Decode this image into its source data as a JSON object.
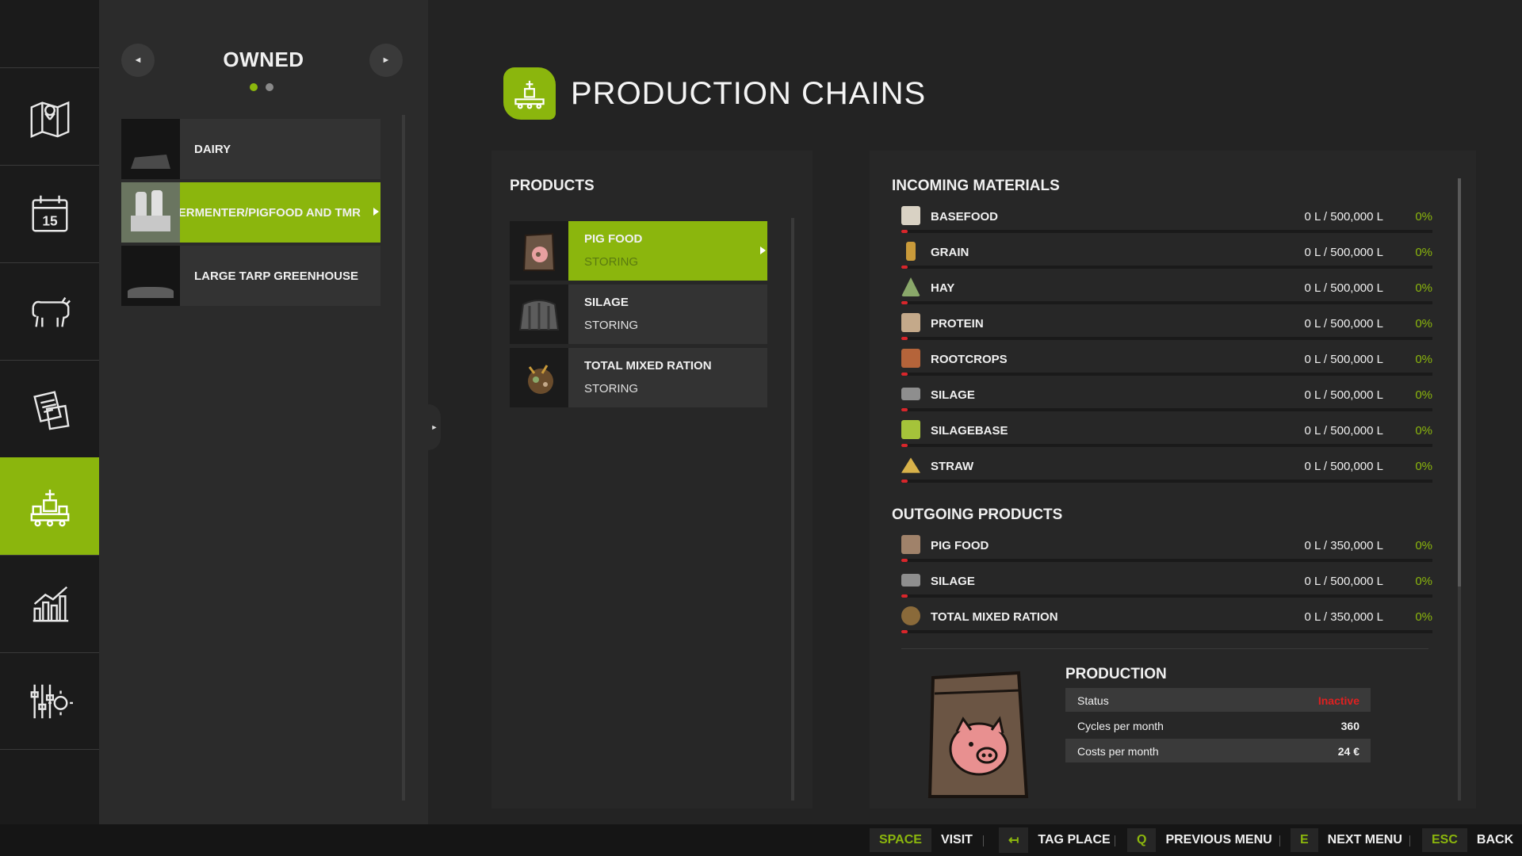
{
  "rail": {
    "items": [
      {
        "name": "map-icon"
      },
      {
        "name": "calendar-icon",
        "text": "15"
      },
      {
        "name": "animals-icon"
      },
      {
        "name": "contracts-icon"
      },
      {
        "name": "production-icon",
        "active": true
      },
      {
        "name": "statistics-icon"
      },
      {
        "name": "settings-icon"
      }
    ]
  },
  "owned": {
    "title": "OWNED",
    "prev": "◄",
    "next": "►",
    "items": [
      {
        "label": "DAIRY"
      },
      {
        "label": "FERMENTER/PIGFOOD AND TMR",
        "active": true
      },
      {
        "label": "LARGE TARP GREENHOUSE"
      }
    ]
  },
  "header": {
    "title": "PRODUCTION CHAINS"
  },
  "products": {
    "title": "PRODUCTS",
    "items": [
      {
        "name": "PIG FOOD",
        "state": "STORING",
        "active": true
      },
      {
        "name": "SILAGE",
        "state": "STORING"
      },
      {
        "name": "TOTAL MIXED RATION",
        "state": "STORING"
      }
    ]
  },
  "incoming": {
    "title": "INCOMING MATERIALS",
    "items": [
      {
        "name": "BASEFOOD",
        "amount": "0 L / 500,000 L",
        "percent": "0%",
        "icon": "basefood-icon",
        "color": "#d9d2c4"
      },
      {
        "name": "GRAIN",
        "amount": "0 L / 500,000 L",
        "percent": "0%",
        "icon": "grain-icon",
        "color": "#c99a3a"
      },
      {
        "name": "HAY",
        "amount": "0 L / 500,000 L",
        "percent": "0%",
        "icon": "hay-icon",
        "color": "#8aa86a"
      },
      {
        "name": "PROTEIN",
        "amount": "0 L / 500,000 L",
        "percent": "0%",
        "icon": "protein-icon",
        "color": "#c4a98a"
      },
      {
        "name": "ROOTCROPS",
        "amount": "0 L / 500,000 L",
        "percent": "0%",
        "icon": "rootcrops-icon",
        "color": "#b5643a"
      },
      {
        "name": "SILAGE",
        "amount": "0 L / 500,000 L",
        "percent": "0%",
        "icon": "silage-icon",
        "color": "#8e8e8e"
      },
      {
        "name": "SILAGEBASE",
        "amount": "0 L / 500,000 L",
        "percent": "0%",
        "icon": "silagebase-icon",
        "color": "#a5c33a"
      },
      {
        "name": "STRAW",
        "amount": "0 L / 500,000 L",
        "percent": "0%",
        "icon": "straw-icon",
        "color": "#d8b24a"
      }
    ]
  },
  "outgoing": {
    "title": "OUTGOING PRODUCTS",
    "items": [
      {
        "name": "PIG FOOD",
        "amount": "0 L / 350,000 L",
        "percent": "0%",
        "icon": "pigfood-icon",
        "color": "#a0826a"
      },
      {
        "name": "SILAGE",
        "amount": "0 L / 500,000 L",
        "percent": "0%",
        "icon": "silage-icon",
        "color": "#8e8e8e"
      },
      {
        "name": "TOTAL MIXED RATION",
        "amount": "0 L / 350,000 L",
        "percent": "0%",
        "icon": "tmr-icon",
        "color": "#8a6a3a"
      }
    ]
  },
  "production": {
    "title": "PRODUCTION",
    "status_label": "Status",
    "status_value": "Inactive",
    "cycles_label": "Cycles per month",
    "cycles_value": "360",
    "costs_label": "Costs per month",
    "costs_value": "24 €"
  },
  "hints": [
    {
      "key": "SPACE",
      "label": "VISIT"
    },
    {
      "key": "↤",
      "label": "TAG PLACE"
    },
    {
      "key": "Q",
      "label": "PREVIOUS MENU"
    },
    {
      "key": "E",
      "label": "NEXT MENU"
    },
    {
      "key": "ESC",
      "label": "BACK"
    }
  ],
  "colors": {
    "accent": "#8bb60d",
    "danger": "#e02020",
    "panel": "#272727"
  }
}
